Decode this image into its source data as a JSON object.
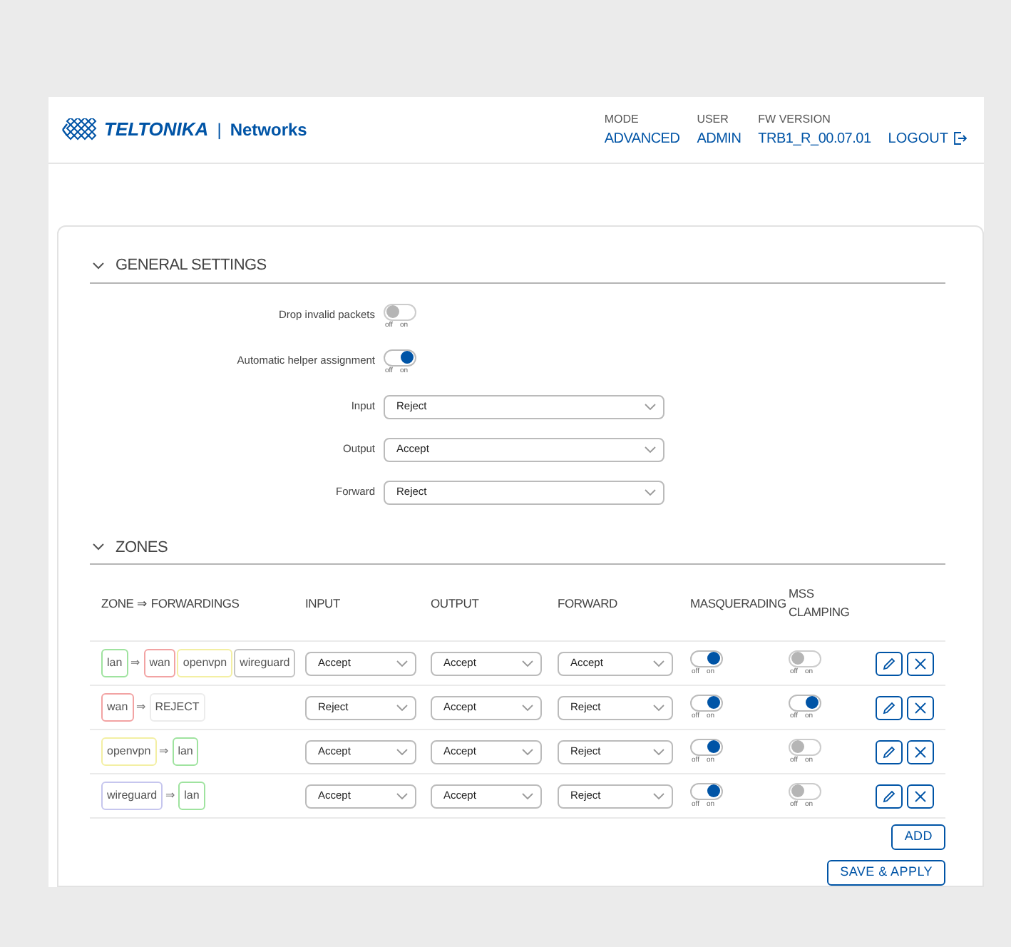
{
  "header": {
    "brand": "TELTONIKA",
    "divider": "|",
    "product": "Networks",
    "info": [
      {
        "label": "MODE",
        "value": "ADVANCED"
      },
      {
        "label": "USER",
        "value": "ADMIN"
      },
      {
        "label": "FW VERSION",
        "value": "TRB1_R_00.07.01"
      }
    ],
    "logout": "LOGOUT"
  },
  "general_settings": {
    "title": "GENERAL SETTINGS",
    "expanded": true,
    "fields": [
      {
        "kind": "toggle",
        "label": "Drop invalid packets",
        "on": false,
        "off_label": "off",
        "on_label": "on"
      },
      {
        "kind": "toggle",
        "label": "Automatic helper assignment",
        "on": true,
        "off_label": "off",
        "on_label": "on"
      },
      {
        "kind": "select",
        "label": "Input",
        "value": "Reject"
      },
      {
        "kind": "select",
        "label": "Output",
        "value": "Accept"
      },
      {
        "kind": "select",
        "label": "Forward",
        "value": "Reject"
      }
    ]
  },
  "zones": {
    "title": "ZONES",
    "expanded": true,
    "columns": [
      "ZONE ⇒ FORWARDINGS",
      "INPUT",
      "OUTPUT",
      "FORWARD",
      "MASQUERADING",
      "MSS CLAMPING"
    ],
    "rows": [
      {
        "zone": {
          "name": "lan",
          "color": "#9fe39f"
        },
        "arrow": "⇒",
        "forwardings": [
          {
            "name": "wan",
            "color": "#f2a3a3"
          },
          {
            "name": "openvpn",
            "color": "#f3efa3"
          },
          {
            "name": "wireguard",
            "color": "#c4c4c4"
          }
        ],
        "input": "Accept",
        "output": "Accept",
        "forward": "Accept",
        "masquerading": {
          "on": true,
          "off_label": "off",
          "on_label": "on"
        },
        "mss_clamping": {
          "on": false,
          "off_label": "off",
          "on_label": "on"
        }
      },
      {
        "zone": {
          "name": "wan",
          "color": "#f2a3a3"
        },
        "arrow": "⇒",
        "forwardings": [
          {
            "name": "REJECT",
            "color": "#ececec"
          }
        ],
        "input": "Reject",
        "output": "Accept",
        "forward": "Reject",
        "masquerading": {
          "on": true,
          "off_label": "off",
          "on_label": "on"
        },
        "mss_clamping": {
          "on": true,
          "off_label": "off",
          "on_label": "on"
        }
      },
      {
        "zone": {
          "name": "openvpn",
          "color": "#f3efa3"
        },
        "arrow": "⇒",
        "forwardings": [
          {
            "name": "lan",
            "color": "#9fe39f"
          }
        ],
        "input": "Accept",
        "output": "Accept",
        "forward": "Reject",
        "masquerading": {
          "on": true,
          "off_label": "off",
          "on_label": "on"
        },
        "mss_clamping": {
          "on": false,
          "off_label": "off",
          "on_label": "on"
        }
      },
      {
        "zone": {
          "name": "wireguard",
          "color": "#c6c6ee"
        },
        "arrow": "⇒",
        "forwardings": [
          {
            "name": "lan",
            "color": "#9fe39f"
          }
        ],
        "input": "Accept",
        "output": "Accept",
        "forward": "Reject",
        "masquerading": {
          "on": true,
          "off_label": "off",
          "on_label": "on"
        },
        "mss_clamping": {
          "on": false,
          "off_label": "off",
          "on_label": "on"
        }
      }
    ],
    "buttons": [
      "ADD",
      "SAVE & APPLY"
    ]
  }
}
